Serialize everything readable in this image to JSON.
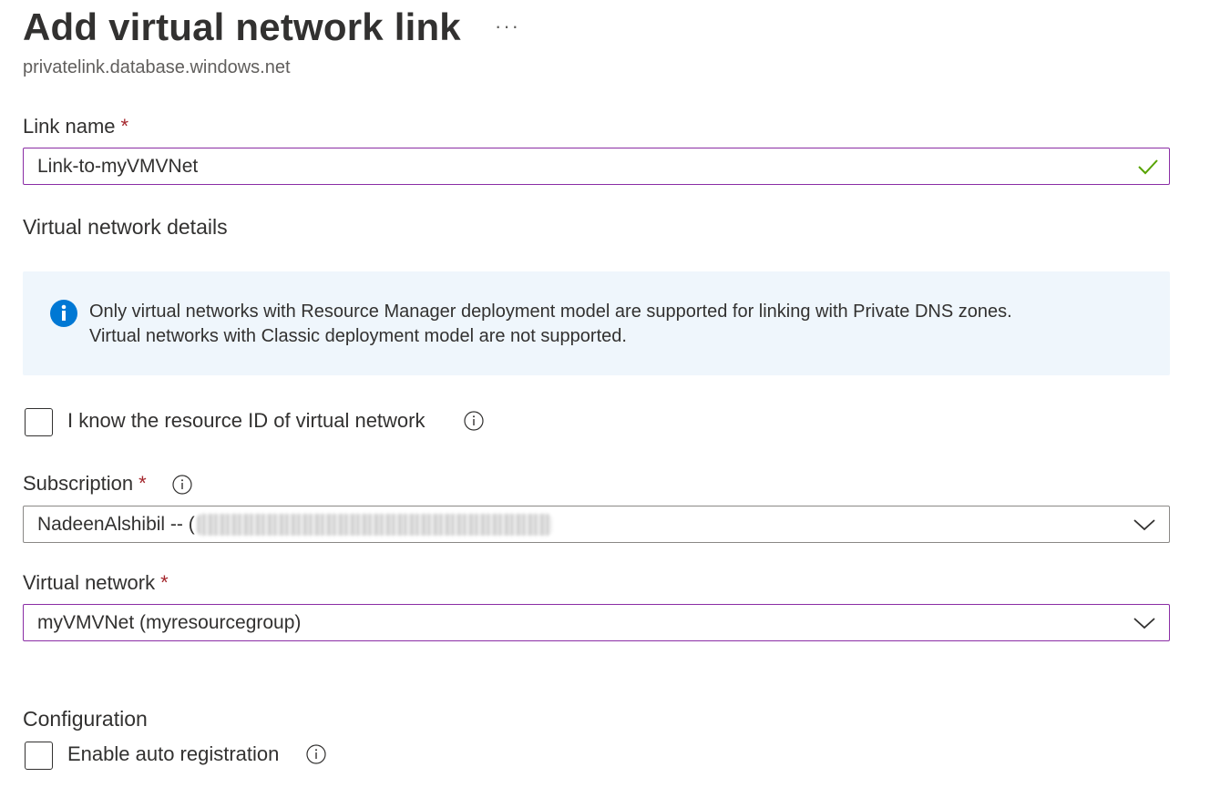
{
  "header": {
    "title": "Add virtual network link",
    "more_label": "···",
    "subtitle": "privatelink.database.windows.net"
  },
  "link_name": {
    "label": "Link name",
    "required_mark": "*",
    "value": "Link-to-myVMVNet",
    "valid_icon": "checkmark-icon"
  },
  "vnet_details": {
    "heading": "Virtual network details",
    "info_icon": "info-icon",
    "info_line1": "Only virtual networks with Resource Manager deployment model are supported for linking with Private DNS zones.",
    "info_line2": "Virtual networks with Classic deployment model are not supported."
  },
  "resource_id": {
    "label": "I know the resource ID of virtual network",
    "checked": false
  },
  "subscription": {
    "label": "Subscription",
    "required_mark": "*",
    "value": "NadeenAlshibil -- ("
  },
  "virtual_network": {
    "label": "Virtual network",
    "required_mark": "*",
    "value": "myVMVNet (myresourcegroup)"
  },
  "configuration": {
    "heading": "Configuration",
    "auto_registration_label": "Enable auto registration",
    "checked": false
  },
  "colors": {
    "accent_border": "#8a2da5",
    "required": "#a4262c",
    "info_blue": "#0078d4",
    "valid_green": "#57a300",
    "info_bg": "#eff6fc"
  }
}
